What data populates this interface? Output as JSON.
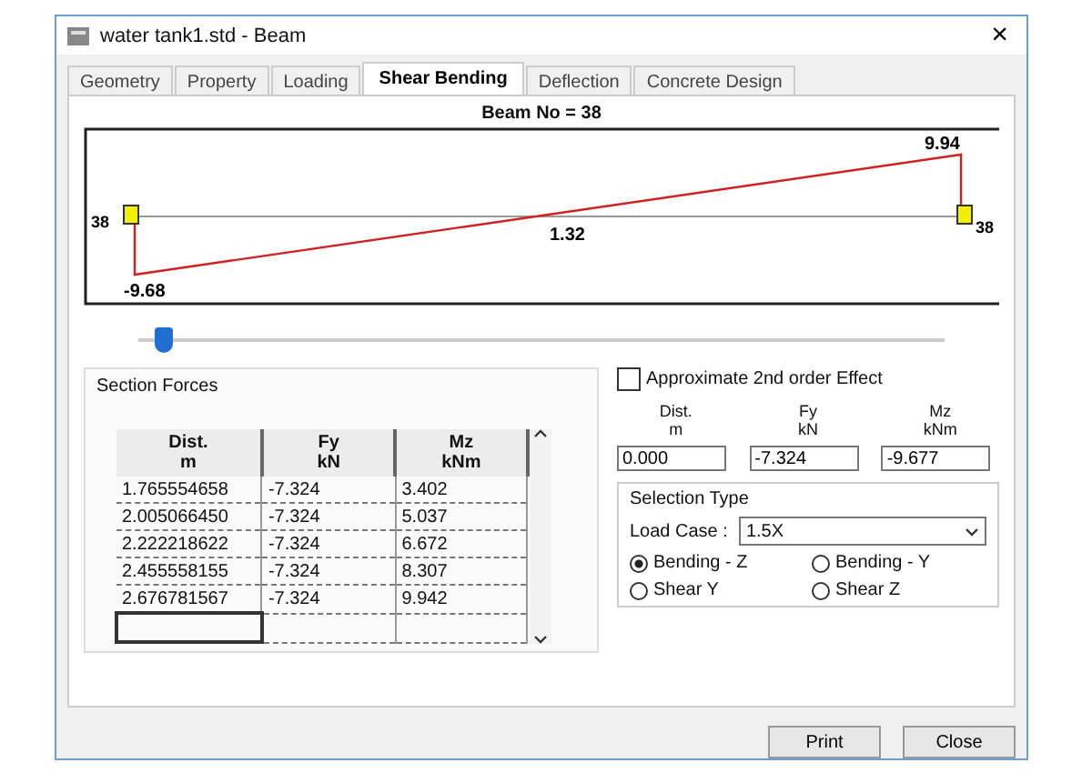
{
  "window": {
    "title": "water tank1.std - Beam",
    "close": "×"
  },
  "tabs": [
    {
      "label": "Geometry",
      "selected": false
    },
    {
      "label": "Property",
      "selected": false
    },
    {
      "label": "Loading",
      "selected": false
    },
    {
      "label": "Shear Bending",
      "selected": true
    },
    {
      "label": "Deflection",
      "selected": false
    },
    {
      "label": "Concrete Design",
      "selected": false
    }
  ],
  "beam_title": "Beam No = 38",
  "diagram": {
    "left_node": "38",
    "right_node": "38",
    "start_value": "-9.68",
    "mid_value": "1.32",
    "end_value": "9.94"
  },
  "position_slider": {
    "level": 0.02
  },
  "section_forces": {
    "title": "Section Forces",
    "columns": [
      "Dist.\nm",
      "Fy\nkN",
      "Mz\nkNm"
    ],
    "rows": [
      [
        "1.765554658",
        "-7.324",
        "3.402"
      ],
      [
        "2.005066450",
        "-7.324",
        "5.037"
      ],
      [
        "2.222218622",
        "-7.324",
        "6.672"
      ],
      [
        "2.455558155",
        "-7.324",
        "8.307"
      ],
      [
        "2.676781567",
        "-7.324",
        "9.942"
      ]
    ]
  },
  "second_order": {
    "label": "Approximate 2nd order Effect",
    "checked": false
  },
  "readouts": [
    {
      "label": "Dist.\nm",
      "value": "0.000"
    },
    {
      "label": "Fy\nkN",
      "value": "-7.324"
    },
    {
      "label": "Mz\nkNm",
      "value": "-9.677"
    }
  ],
  "selection_type": {
    "title": "Selection Type",
    "load_case_label": "Load Case :",
    "load_case": "1.5X",
    "options": [
      {
        "label": "Bending - Z",
        "selected": true
      },
      {
        "label": "Bending - Y",
        "selected": false
      },
      {
        "label": "Shear  Y",
        "selected": false
      },
      {
        "label": "Shear  Z",
        "selected": false
      }
    ]
  },
  "buttons": [
    "Print",
    "Close"
  ]
}
